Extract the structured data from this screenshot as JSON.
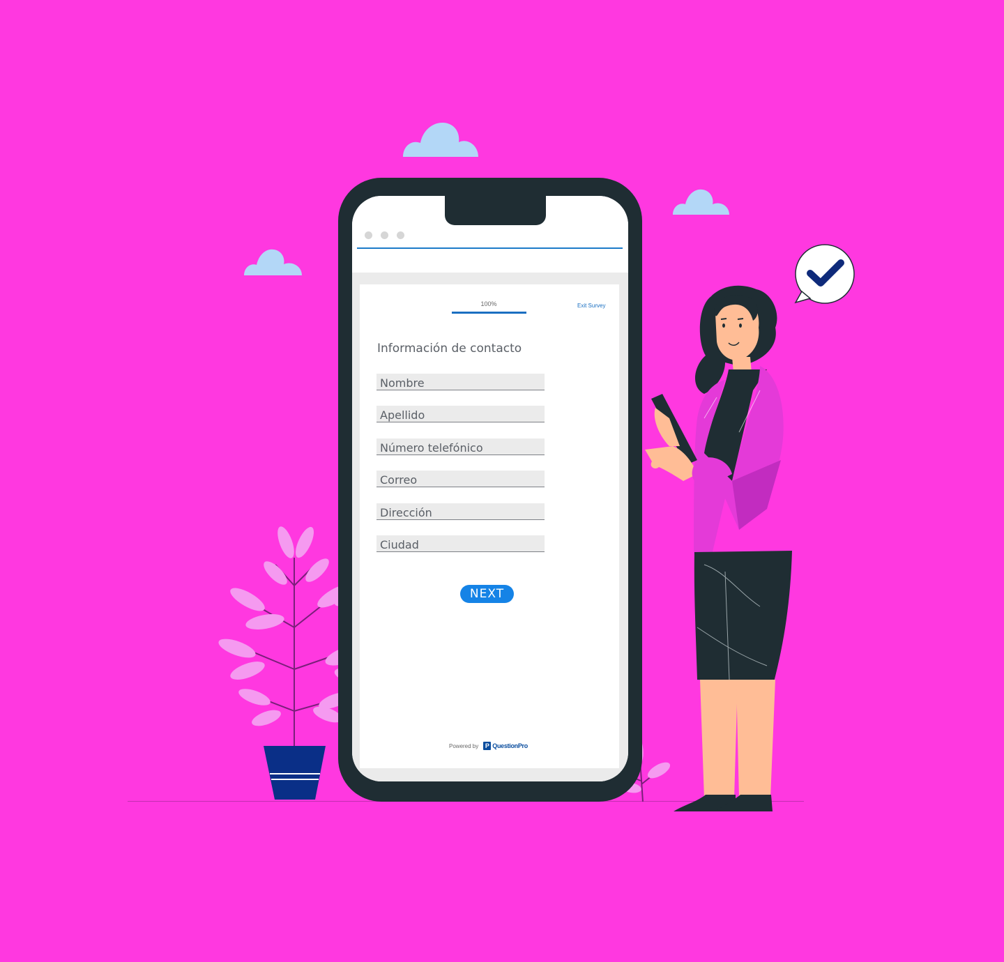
{
  "survey": {
    "progress_label": "100%",
    "progress_fraction": 1.0,
    "exit_label": "Exit Survey",
    "section_title": "Información de contacto",
    "fields": [
      {
        "placeholder": "Nombre"
      },
      {
        "placeholder": "Apellido"
      },
      {
        "placeholder": "Número telefónico"
      },
      {
        "placeholder": "Correo"
      },
      {
        "placeholder": "Dirección"
      },
      {
        "placeholder": "Ciudad"
      }
    ],
    "next_label": "NEXT",
    "powered_by": "Powered by",
    "brand_name": "QuestionPro",
    "brand_mark": "P"
  },
  "colors": {
    "background": "#ff38e0",
    "phone_body": "#1f2d33",
    "accent_blue": "#1583e6",
    "brand_blue": "#0a4d9e",
    "cloud": "#b3d7f7",
    "check_badge": "#0e2a7a"
  },
  "icons": {
    "browser_dots": "window-dots-icon",
    "speech_bubble": "check-bubble-icon"
  }
}
